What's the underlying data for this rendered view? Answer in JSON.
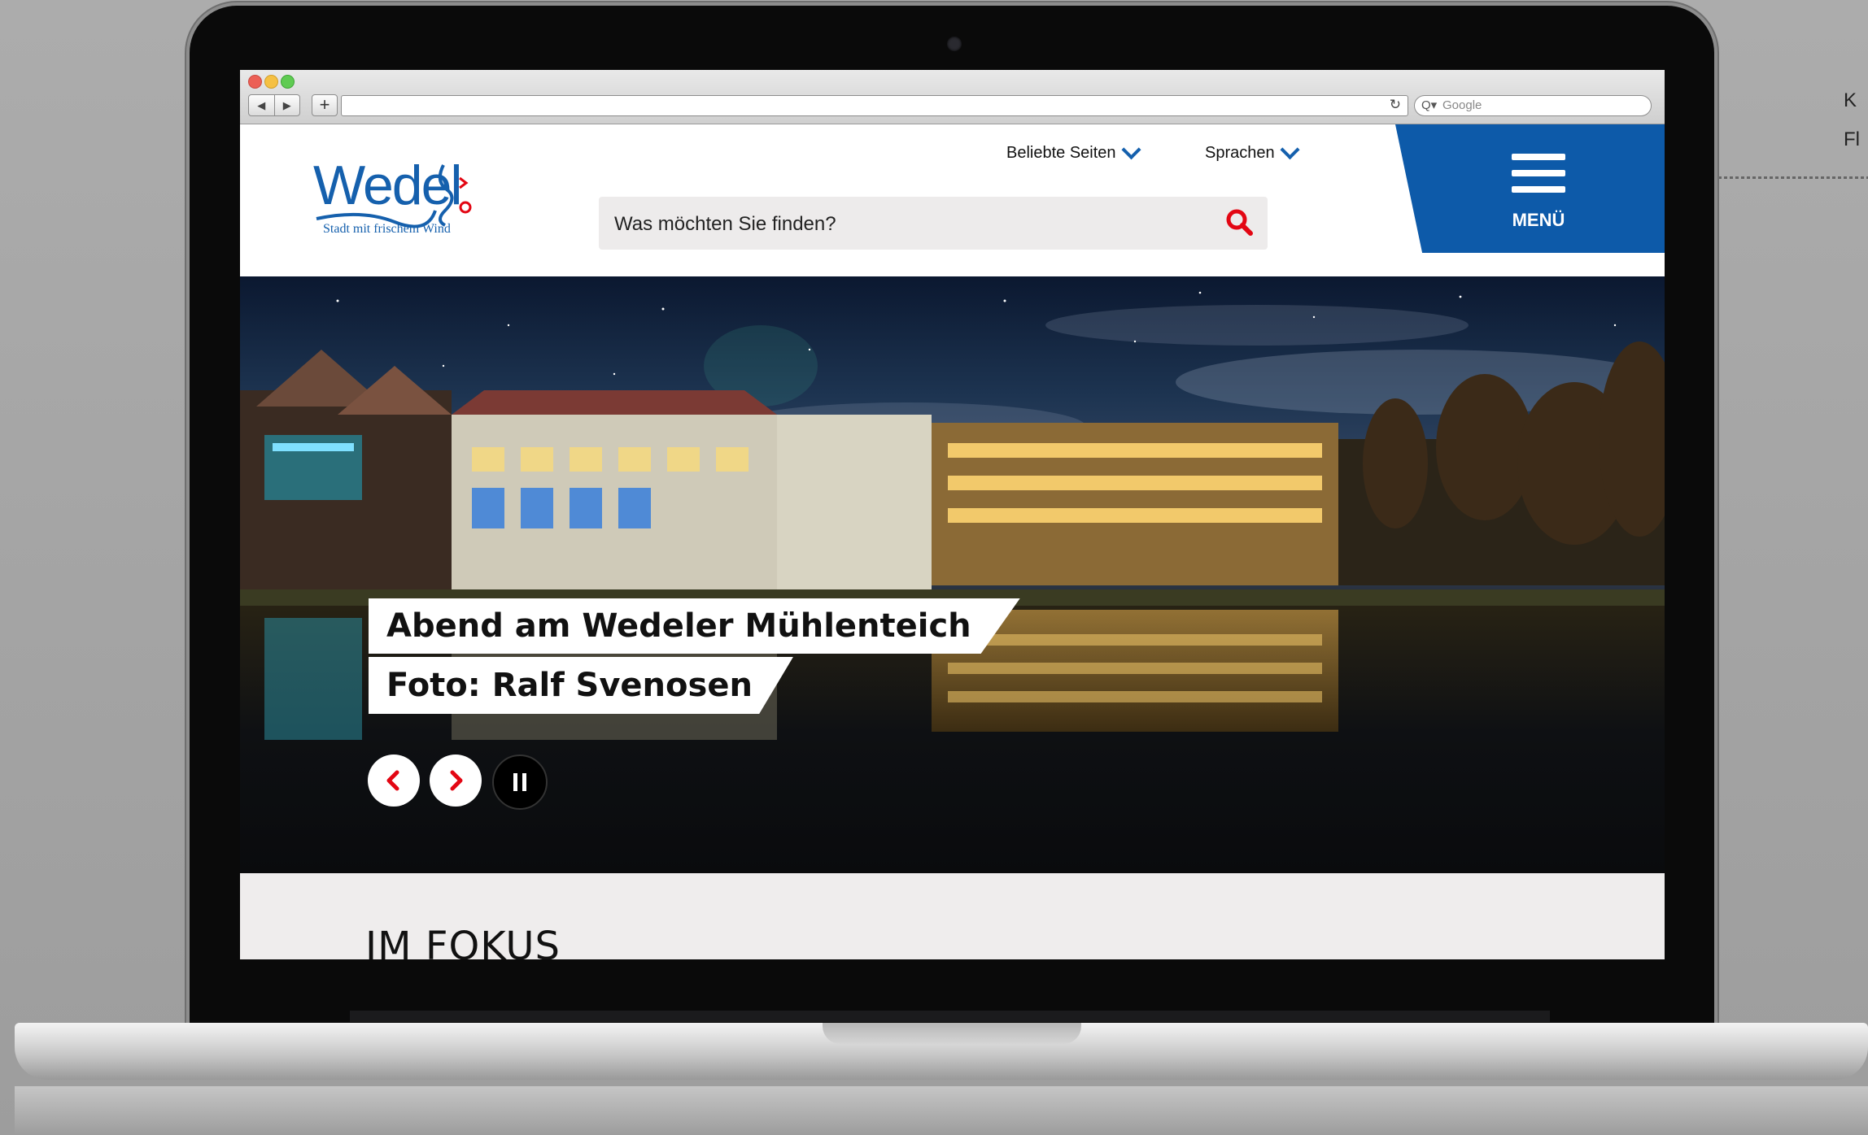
{
  "browser": {
    "search_placeholder": "Google",
    "back_icon": "◀",
    "forward_icon": "▶",
    "new_tab_icon": "+",
    "reload_icon": "↻"
  },
  "site": {
    "logo_text": "Wedel",
    "logo_tagline": "Stadt mit frischem Wind",
    "nav": {
      "popular": "Beliebte Seiten",
      "languages": "Sprachen"
    },
    "search_placeholder": "Was möchten Sie finden?",
    "menu_label": "MENÜ",
    "colors": {
      "brand_blue": "#0d5aa9",
      "accent_red": "#e30613",
      "search_bg": "#edebeb"
    }
  },
  "hero": {
    "caption_title": "Abend am Wedeler Mühlenteich",
    "caption_credit": "Foto: Ralf Svenosen",
    "controls": [
      "prev-icon",
      "next-icon",
      "pause-icon"
    ]
  },
  "focus": {
    "title": "IM FOKUS"
  }
}
